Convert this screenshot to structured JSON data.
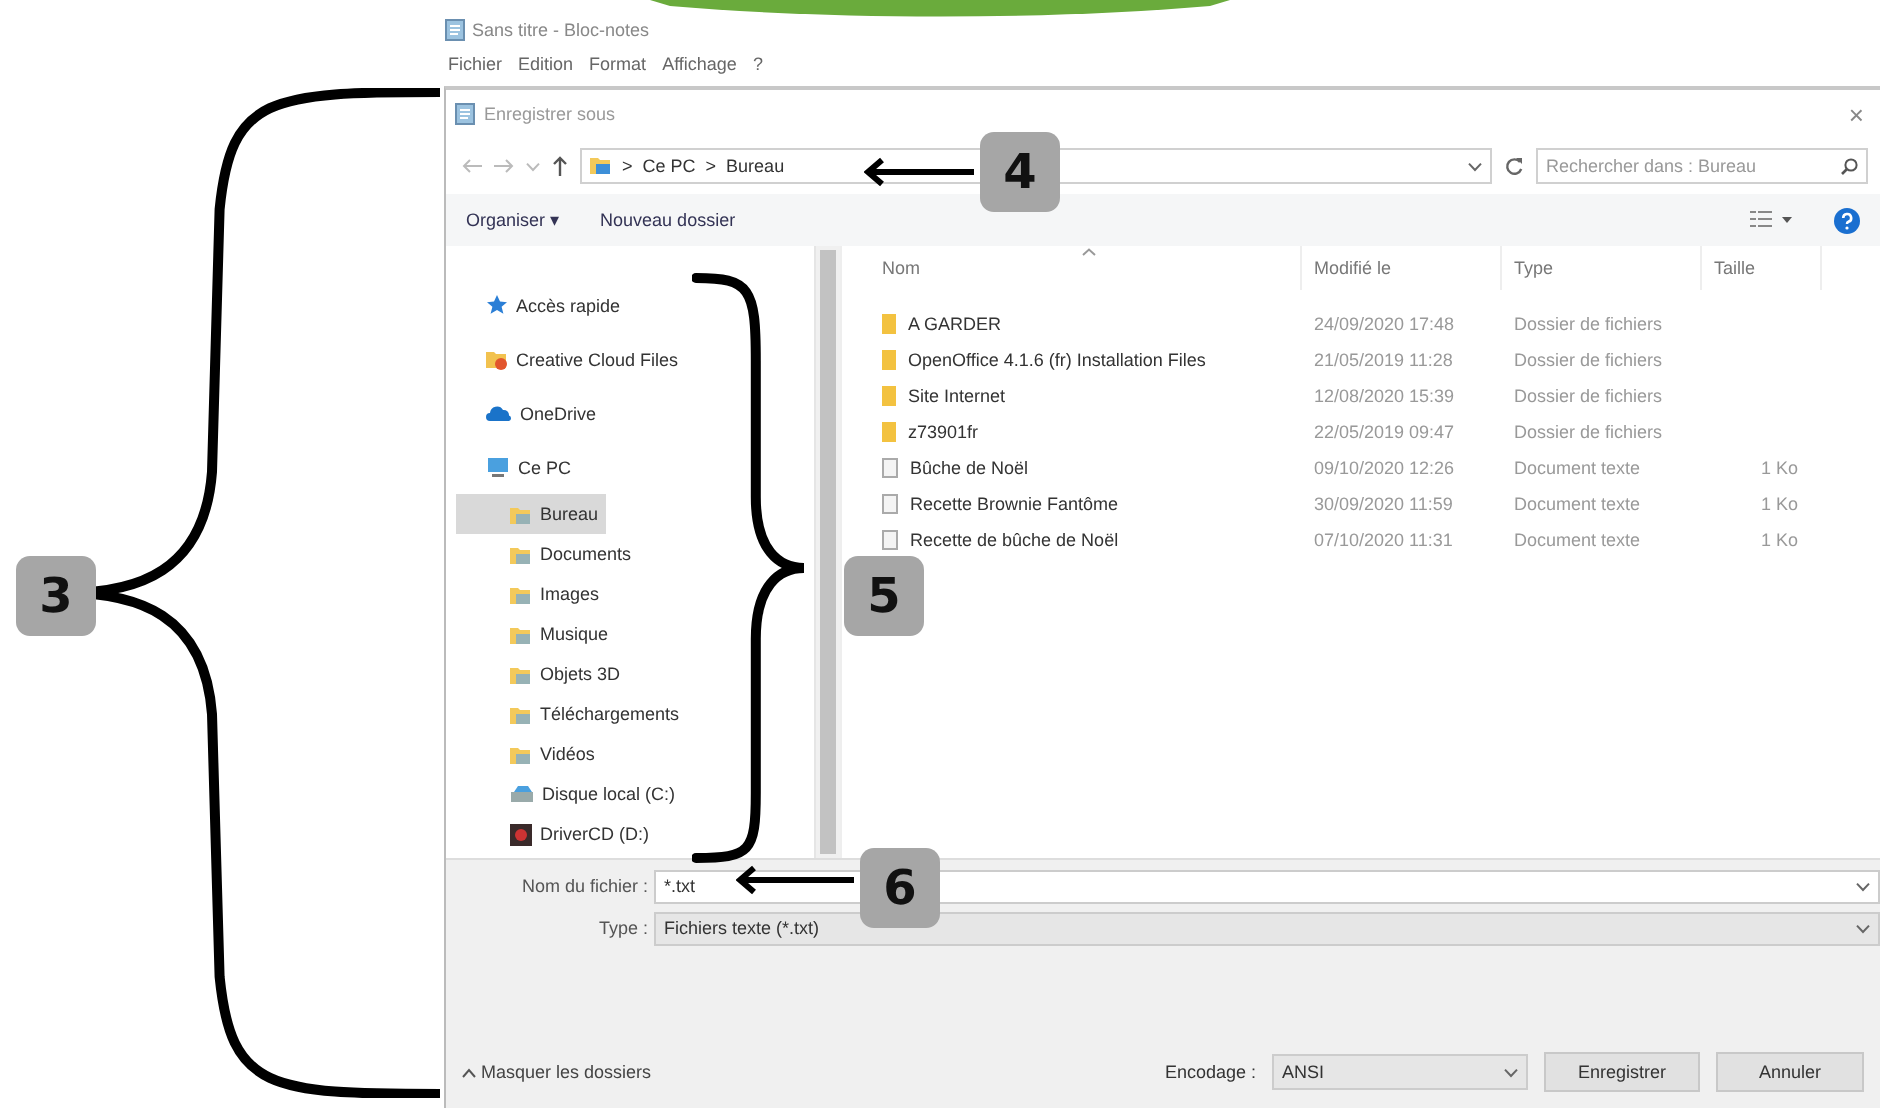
{
  "notepad": {
    "title": "Sans titre - Bloc-notes",
    "menu": [
      "Fichier",
      "Edition",
      "Format",
      "Affichage",
      "?"
    ]
  },
  "dialog": {
    "title": "Enregistrer sous",
    "close": "×",
    "address": {
      "path": [
        "Ce PC",
        "Bureau"
      ],
      "separator": ">"
    },
    "search": {
      "placeholder": "Rechercher dans : Bureau"
    },
    "toolbar": {
      "organize": "Organiser ▾",
      "new_folder": "Nouveau dossier"
    },
    "nav": [
      {
        "label": "Accès rapide",
        "kind": "quick",
        "selected": false
      },
      {
        "label": "Creative Cloud Files",
        "kind": "cloudfiles",
        "selected": false
      },
      {
        "label": "OneDrive",
        "kind": "onedrive",
        "selected": false
      },
      {
        "label": "Ce PC",
        "kind": "pc",
        "selected": false,
        "children": [
          {
            "label": "Bureau",
            "kind": "folder",
            "selected": true
          },
          {
            "label": "Documents",
            "kind": "folder",
            "selected": false
          },
          {
            "label": "Images",
            "kind": "folder",
            "selected": false
          },
          {
            "label": "Musique",
            "kind": "folder",
            "selected": false
          },
          {
            "label": "Objets 3D",
            "kind": "folder",
            "selected": false
          },
          {
            "label": "Téléchargements",
            "kind": "folder",
            "selected": false
          },
          {
            "label": "Vidéos",
            "kind": "folder",
            "selected": false
          },
          {
            "label": "Disque local (C:)",
            "kind": "disk",
            "selected": false
          },
          {
            "label": "DriverCD (D:)",
            "kind": "cd",
            "selected": false
          }
        ]
      }
    ],
    "columns": [
      "Nom",
      "Modifié le",
      "Type",
      "Taille"
    ],
    "files": [
      {
        "name": "A GARDER",
        "modified": "24/09/2020 17:48",
        "type": "Dossier de fichiers",
        "kind": "folder"
      },
      {
        "name": "OpenOffice 4.1.6 (fr) Installation Files",
        "modified": "21/05/2019 11:28",
        "type": "Dossier de fichiers",
        "kind": "folder"
      },
      {
        "name": "Site Internet",
        "modified": "12/08/2020 15:39",
        "type": "Dossier de fichiers",
        "kind": "folder"
      },
      {
        "name": "z73901fr",
        "modified": "22/05/2019 09:47",
        "type": "Dossier de fichiers",
        "kind": "folder"
      },
      {
        "name": "Bûche de Noël",
        "modified": "09/10/2020 12:26",
        "type": "Document texte",
        "size": "1 Ko",
        "kind": "text"
      },
      {
        "name": "Recette Brownie Fantôme",
        "modified": "30/09/2020 11:59",
        "type": "Document texte",
        "size": "1 Ko",
        "kind": "text"
      },
      {
        "name": "Recette de bûche de Noël",
        "modified": "07/10/2020 11:31",
        "type": "Document texte",
        "size": "1 Ko",
        "kind": "text"
      }
    ],
    "filename": {
      "label": "Nom du fichier :",
      "value": "*.txt"
    },
    "filetype": {
      "label": "Type :",
      "value": "Fichiers texte (*.txt)"
    },
    "hide_folders": "Masquer les dossiers",
    "encoding": {
      "label": "Encodage :",
      "value": "ANSI"
    },
    "buttons": [
      "Enregistrer",
      "Annuler"
    ]
  },
  "annotations": [
    {
      "label": "3",
      "kind": "brace"
    },
    {
      "label": "4",
      "kind": "arrow"
    },
    {
      "label": "5",
      "kind": "brace"
    },
    {
      "label": "6",
      "kind": "arrow"
    }
  ]
}
